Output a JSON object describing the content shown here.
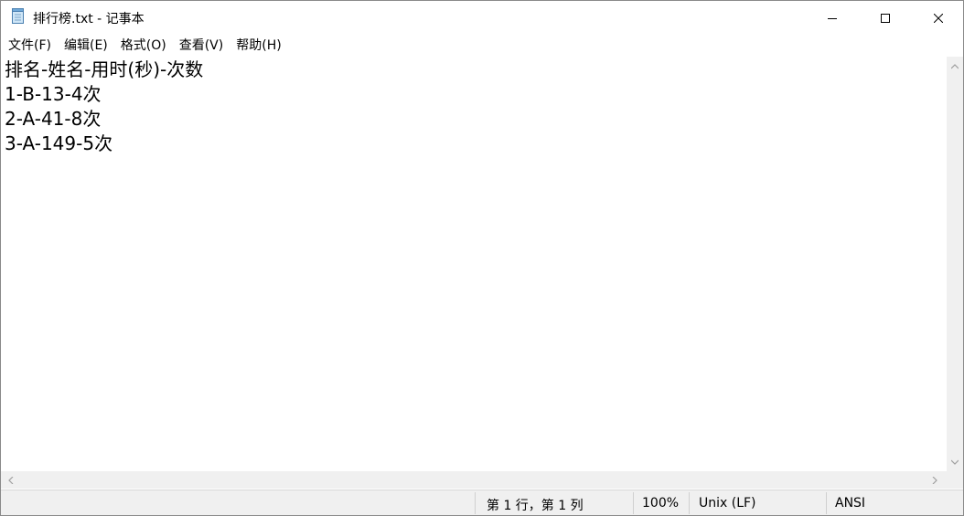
{
  "window": {
    "title": "排行榜.txt - 记事本",
    "icon": "notepad-icon",
    "controls": {
      "minimize_icon": "minimize-icon",
      "maximize_icon": "maximize-icon",
      "close_icon": "close-icon"
    }
  },
  "menu": {
    "items": [
      {
        "label": "文件(F)"
      },
      {
        "label": "编辑(E)"
      },
      {
        "label": "格式(O)"
      },
      {
        "label": "查看(V)"
      },
      {
        "label": "帮助(H)"
      }
    ]
  },
  "editor": {
    "lines": [
      "排名-姓名-用时(秒)-次数",
      "1-B-13-4次",
      "2-A-41-8次",
      "3-A-149-5次"
    ]
  },
  "statusbar": {
    "position": "第 1 行，第 1 列",
    "zoom": "100%",
    "line_ending": "Unix (LF)",
    "encoding": "ANSI"
  },
  "colors": {
    "chrome_bg": "#f0f0f0",
    "editor_bg": "#ffffff",
    "text": "#000000"
  }
}
